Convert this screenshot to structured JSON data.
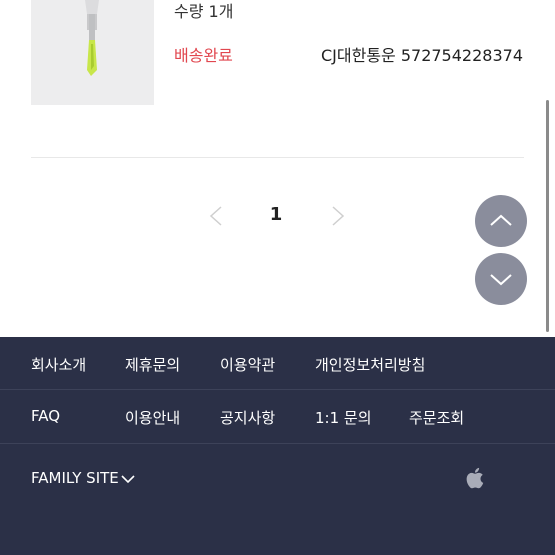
{
  "order": {
    "quantity": "수량 1개",
    "status": "배송완료",
    "tracking": "CJ대한통운 572754228374"
  },
  "pagination": {
    "current_page": "1"
  },
  "footer": {
    "row1": [
      "회사소개",
      "제휴문의",
      "이용약관",
      "개인정보처리방침"
    ],
    "row2": [
      "FAQ",
      "이용안내",
      "공지사항",
      "1:1 문의",
      "주문조회"
    ],
    "family_site": "FAMILY SITE"
  },
  "colors": {
    "status": "#e1474f",
    "footer_bg": "#2b3047",
    "fab_bg": "#8a8d9c"
  },
  "icons": [
    "chevron-left-icon",
    "chevron-right-icon",
    "arrow-up-icon",
    "arrow-down-icon",
    "chevron-down-icon",
    "apple-icon"
  ]
}
